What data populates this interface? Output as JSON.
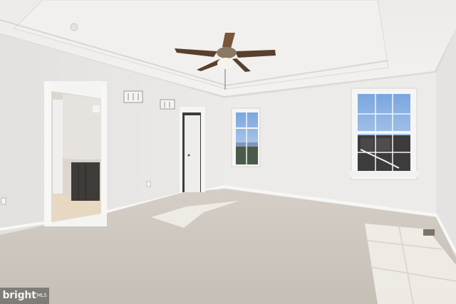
{
  "watermark": {
    "brand": "bright",
    "suffix": "MLS"
  },
  "colors": {
    "wall": "#e9e8e6",
    "ceiling": "#efeeec",
    "carpet": "#cdc6bd",
    "sky": "#8fb4e0",
    "cabinet": "#3d3a38"
  }
}
